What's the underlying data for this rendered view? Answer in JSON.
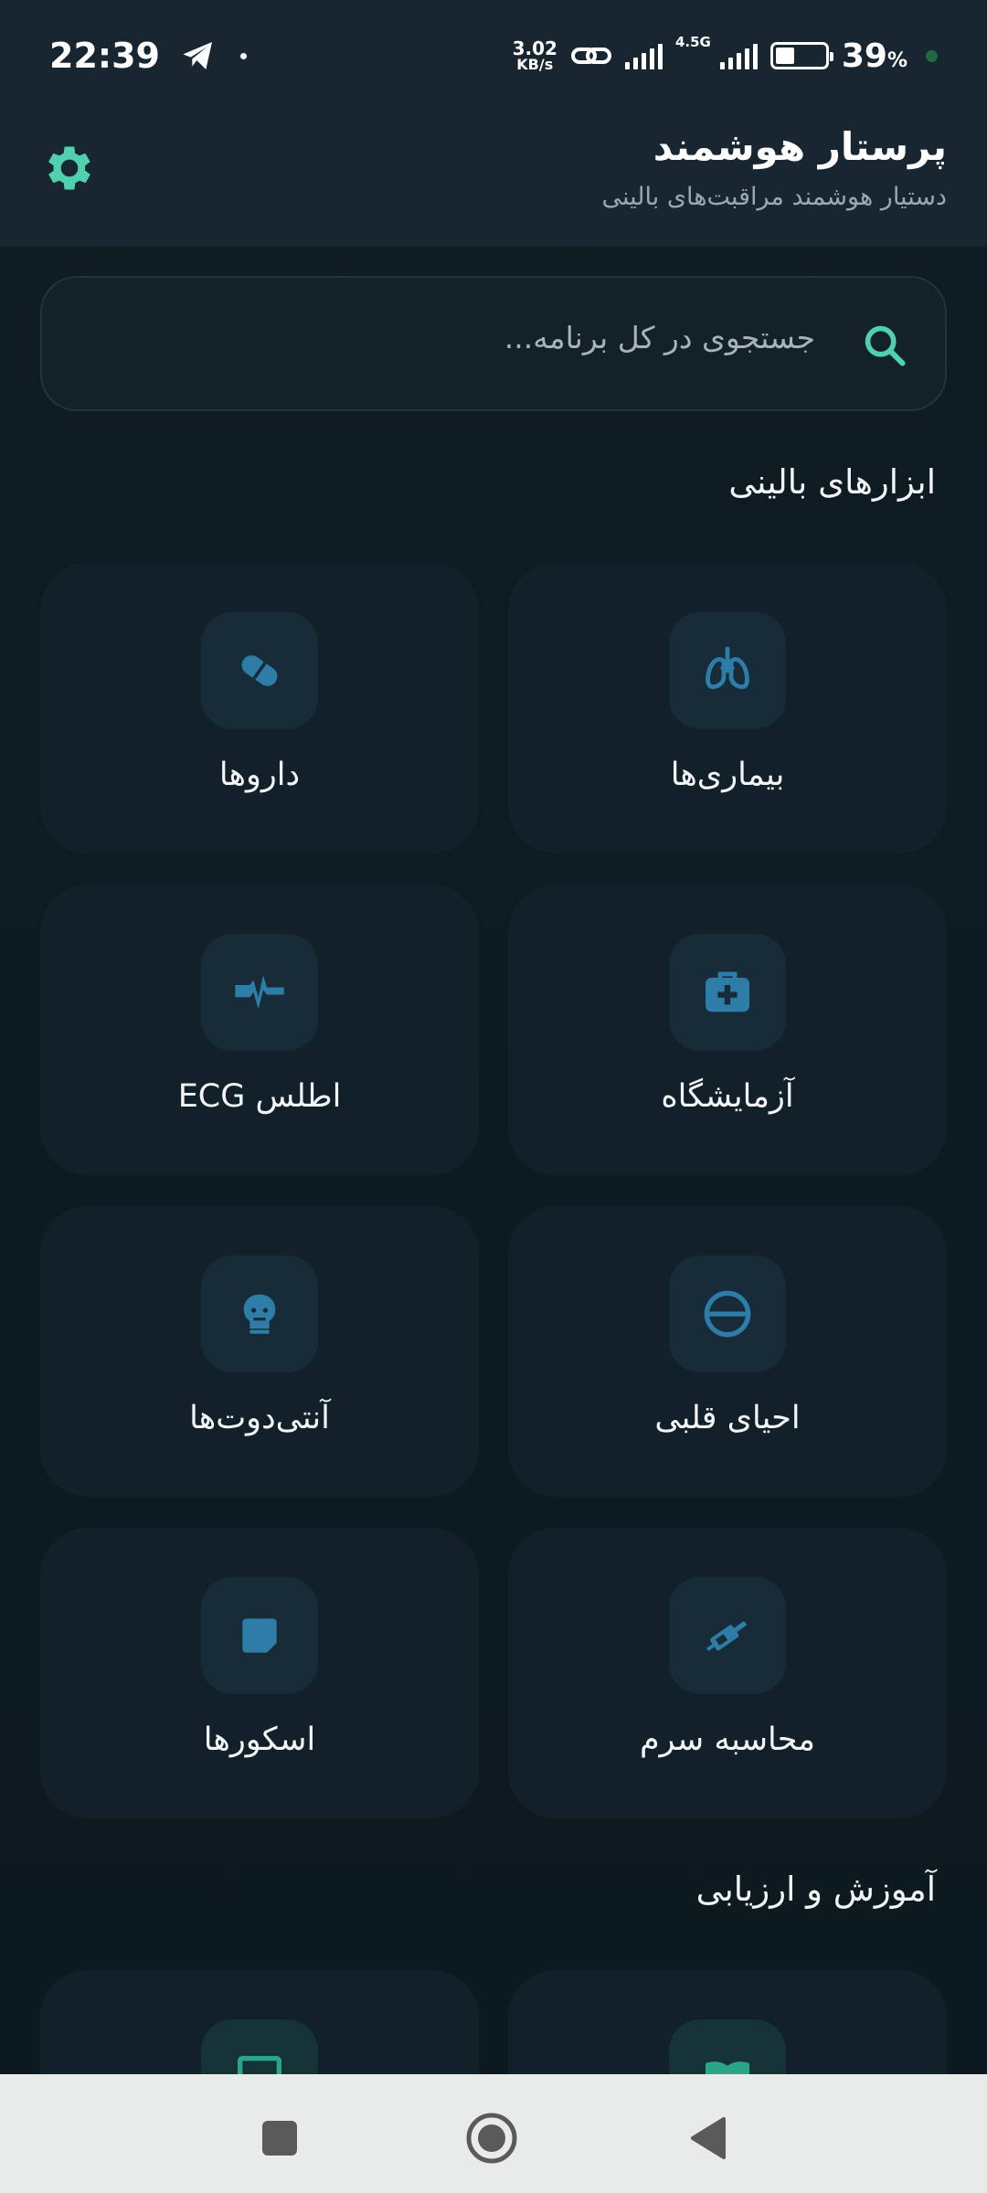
{
  "status_bar": {
    "time": "22:39",
    "speed_value": "3.02",
    "speed_unit": "KB/s",
    "network": "4.5G",
    "battery_percent": "39",
    "battery_unit": "%",
    "battery_level": 0.39
  },
  "header": {
    "title": "پرستار هوشمند",
    "subtitle": "دستیار هوشمند مراقبت‌های بالینی",
    "settings_icon": "gear-icon"
  },
  "search": {
    "placeholder": "جستجوی در کل برنامه..."
  },
  "sections": {
    "clinical_tools": "ابزارهای بالینی",
    "education": "آموزش و ارزیابی"
  },
  "cards": [
    {
      "label": "بیماری‌ها",
      "icon": "lungs-icon"
    },
    {
      "label": "داروها",
      "icon": "pill-icon"
    },
    {
      "label": "آزمایشگاه",
      "icon": "medical-kit-icon"
    },
    {
      "label": "اطلس ECG",
      "icon": "heartbeat-icon"
    },
    {
      "label": "احیای قلبی",
      "icon": "no-entry-icon"
    },
    {
      "label": "آنتی‌دوت‌ها",
      "icon": "skull-icon"
    },
    {
      "label": "محاسبه سرم",
      "icon": "iv-drip-icon"
    },
    {
      "label": "اسکورها",
      "icon": "note-icon"
    }
  ],
  "colors": {
    "accent": "#4fd1b0",
    "icon_blue": "#2e7ca8",
    "card_bg": "#122129",
    "background": "#0e1a21"
  }
}
